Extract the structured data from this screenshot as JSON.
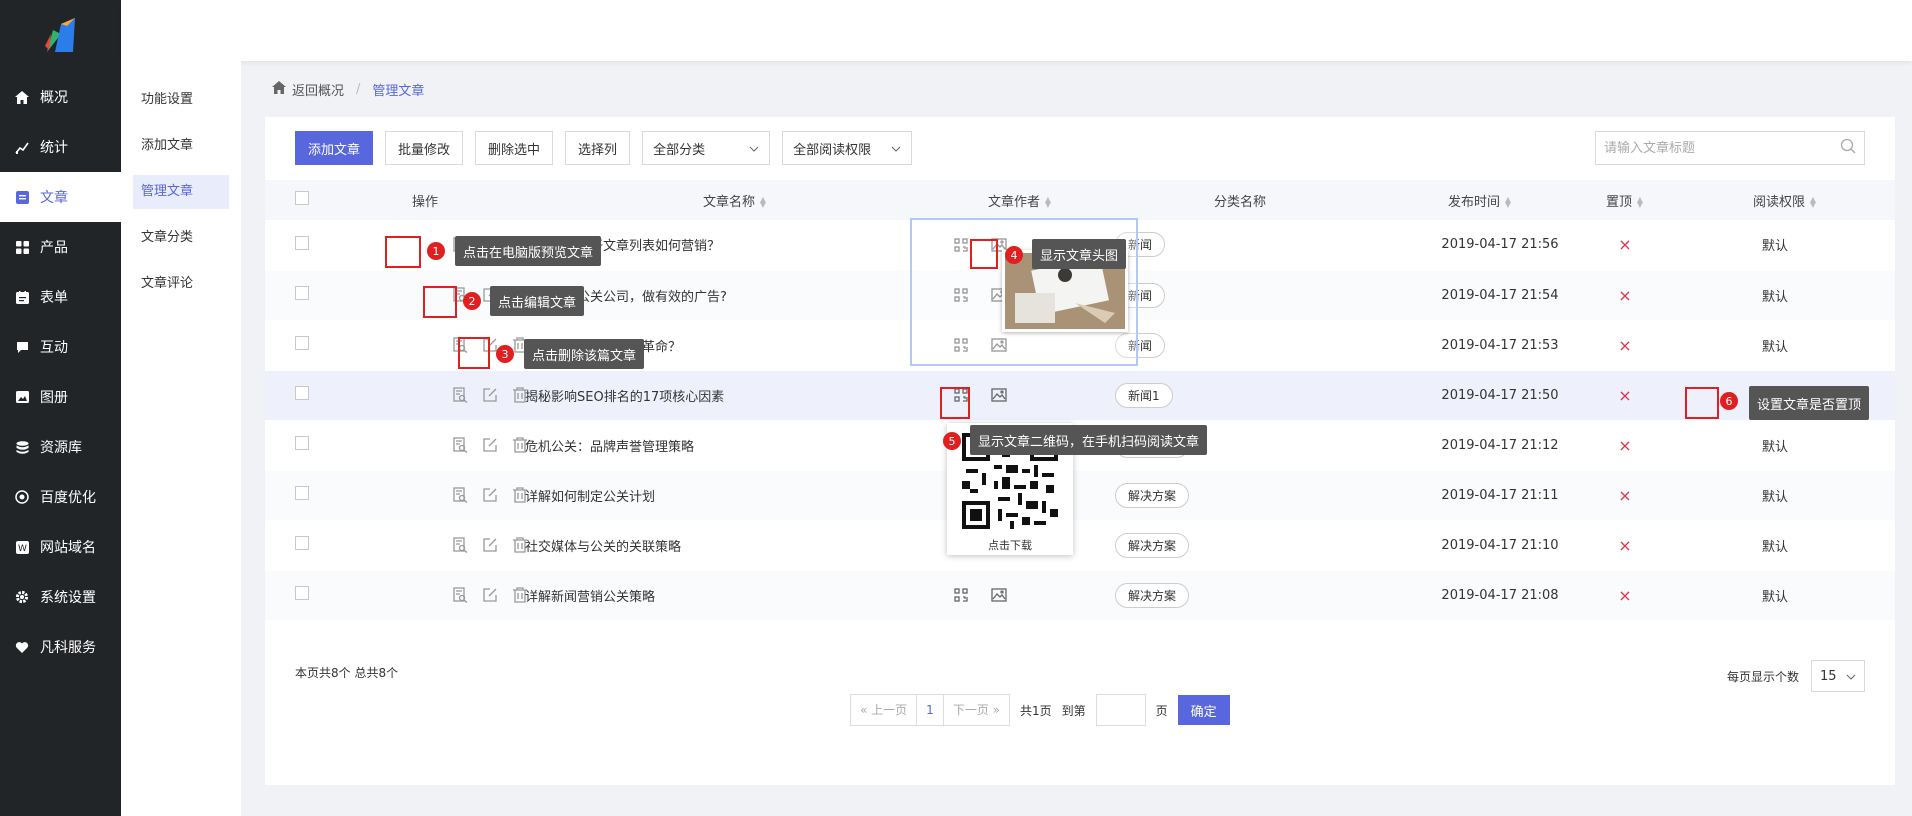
{
  "nav": {
    "items": [
      {
        "label": "概况",
        "icon": "home-icon"
      },
      {
        "label": "统计",
        "icon": "chart-icon"
      },
      {
        "label": "文章",
        "icon": "article-icon"
      },
      {
        "label": "产品",
        "icon": "grid-icon"
      },
      {
        "label": "表单",
        "icon": "form-icon"
      },
      {
        "label": "互动",
        "icon": "chat-icon"
      },
      {
        "label": "图册",
        "icon": "album-icon"
      },
      {
        "label": "资源库",
        "icon": "database-icon"
      },
      {
        "label": "百度优化",
        "icon": "seo-icon"
      },
      {
        "label": "网站域名",
        "icon": "domain-icon"
      },
      {
        "label": "系统设置",
        "icon": "gear-icon"
      },
      {
        "label": "凡科服务",
        "icon": "heart-icon"
      }
    ]
  },
  "subnav": [
    "功能设置",
    "添加文章",
    "管理文章",
    "文章分类",
    "文章评论"
  ],
  "breadcrumb": {
    "back": "返回概况",
    "sep": "/",
    "current": "管理文章"
  },
  "toolbar": {
    "add": "添加文章",
    "batch": "批量修改",
    "delete": "删除选中",
    "columns": "选择列",
    "category": "全部分类",
    "permission": "全部阅读权限"
  },
  "search": {
    "placeholder": "请输入文章标题"
  },
  "table": {
    "headers": {
      "ops": "操作",
      "name": "文章名称",
      "author": "文章作者",
      "category": "分类名称",
      "time": "发布时间",
      "top": "置顶",
      "perm": "阅读权限"
    },
    "rows": [
      {
        "name": "在电脑版打开文章列表如何营销？",
        "category": "新闻",
        "time": "2019-04-17 21:56",
        "top": "×",
        "perm": "默认"
      },
      {
        "name": "如何把握公关公司，做有效的广告?",
        "category": "新闻",
        "time": "2019-04-17 21:54",
        "top": "×",
        "perm": "默认"
      },
      {
        "name": "公关会是营销行业的革命？",
        "category": "新闻",
        "time": "2019-04-17 21:53",
        "top": "×",
        "perm": "默认"
      },
      {
        "name": "揭秘影响SEO排名的17项核心因素",
        "category": "新闻1",
        "time": "2019-04-17 21:50",
        "top": "×",
        "perm": "默认"
      },
      {
        "name": "危机公关：品牌声誉管理策略",
        "category": "解决方案",
        "time": "2019-04-17 21:12",
        "top": "×",
        "perm": "默认"
      },
      {
        "name": "详解如何制定公关计划",
        "category": "解决方案",
        "time": "2019-04-17 21:11",
        "top": "×",
        "perm": "默认"
      },
      {
        "name": "社交媒体与公关的关联策略",
        "category": "解决方案",
        "time": "2019-04-17 21:10",
        "top": "×",
        "perm": "默认"
      },
      {
        "name": "详解新闻营销公关策略",
        "category": "解决方案",
        "time": "2019-04-17 21:08",
        "top": "×",
        "perm": "默认"
      }
    ]
  },
  "annotations": {
    "n1": "1",
    "t1": "点击在电脑版预览文章",
    "n2": "2",
    "t2": "点击编辑文章",
    "n3": "3",
    "t3": "点击删除该篇文章",
    "n4": "4",
    "t4": "显示文章头图",
    "n5": "5",
    "t5": "显示文章二维码，在手机扫码阅读文章",
    "n6": "6",
    "t6": "设置文章是否置顶"
  },
  "qr": {
    "download": "点击下载"
  },
  "footer": {
    "count": "本页共8个   总共8个",
    "per_page_label": "每页显示个数",
    "per_page": "15",
    "prev": "上一页",
    "page": "1",
    "next": "下一页",
    "total_pages": "共1页",
    "goto": "到第",
    "page_unit": "页",
    "confirm": "确定"
  },
  "colors": {
    "accent": "#5867dd",
    "nav_bg": "#222527",
    "danger": "#e02020"
  }
}
